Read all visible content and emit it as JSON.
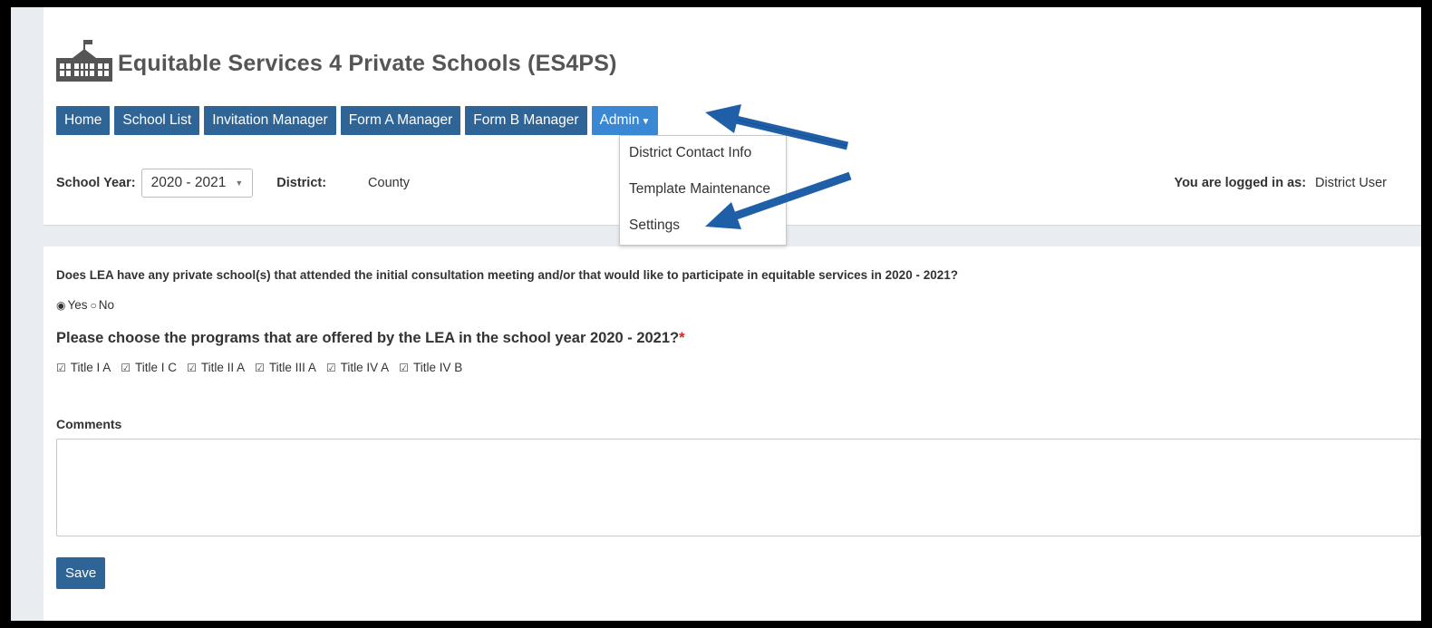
{
  "app": {
    "title": "Equitable Services 4 Private Schools (ES4PS)"
  },
  "nav": {
    "items": [
      {
        "label": "Home"
      },
      {
        "label": "School List"
      },
      {
        "label": "Invitation Manager"
      },
      {
        "label": "Form A Manager"
      },
      {
        "label": "Form B Manager"
      },
      {
        "label": "Admin"
      }
    ],
    "active": "Admin"
  },
  "admin_menu": {
    "items": [
      {
        "label": "District Contact Info"
      },
      {
        "label": "Template Maintenance"
      },
      {
        "label": "Settings"
      }
    ]
  },
  "filters": {
    "school_year_label": "School Year:",
    "school_year_value": "2020 - 2021",
    "district_label": "District:",
    "district_value": "County",
    "logged_label": "You are logged in as:",
    "logged_value": "District User"
  },
  "form": {
    "question": "Does LEA have any private school(s) that attended the initial consultation meeting and/or that would like to participate in equitable services in 2020 - 2021?",
    "yes_label": "Yes",
    "no_label": "No",
    "selected": "Yes",
    "programs_heading": "Please choose the programs that are offered by the LEA in the school year 2020 - 2021?",
    "required_mark": "*",
    "programs": [
      {
        "label": "Title I A",
        "checked": true
      },
      {
        "label": "Title I C",
        "checked": true
      },
      {
        "label": "Title II A",
        "checked": true
      },
      {
        "label": "Title III A",
        "checked": true
      },
      {
        "label": "Title IV A",
        "checked": true
      },
      {
        "label": "Title IV B",
        "checked": true
      }
    ],
    "comments_label": "Comments",
    "comments_value": "",
    "save_label": "Save"
  },
  "colors": {
    "nav_button": "#2f6496",
    "nav_active": "#3a87d4",
    "annotation_arrow": "#1f5fa8"
  }
}
